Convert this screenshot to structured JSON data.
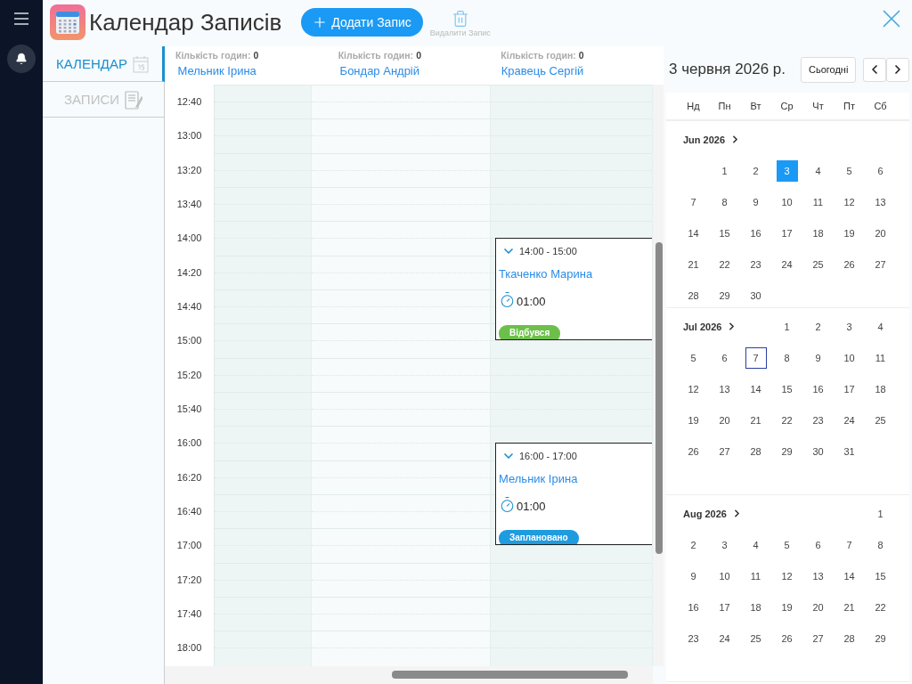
{
  "app": {
    "title": "Календар Записів",
    "add_button": "Додати Запис",
    "delete_button": "Видалити Запис"
  },
  "nav": [
    {
      "label": "КАЛЕНДАР",
      "kind": "calendar",
      "selected": true
    },
    {
      "label": "ЗАПИСИ",
      "kind": "records",
      "selected": false
    }
  ],
  "columns": [
    {
      "hours_label": "Кількість годин:",
      "hours": "0",
      "name": "Мельник Ірина"
    },
    {
      "hours_label": "Кількість годин:",
      "hours": "0",
      "name": "Бондар Андрій"
    },
    {
      "hours_label": "Кількість годин:",
      "hours": "0",
      "name": "Кравець Сергій",
      "events": [
        {
          "time": "14:00 - 15:00",
          "client": "Ткаченко Марина",
          "duration": "01:00",
          "status": "Відбувся",
          "color": "#6cc04a"
        },
        {
          "time": "16:00 - 17:00",
          "client": "Мельник Ірина",
          "duration": "01:00",
          "status": "Заплановано",
          "color": "#1f9be0"
        }
      ]
    }
  ],
  "times": [
    "12:40",
    "13:00",
    "13:20",
    "13:40",
    "14:00",
    "14:20",
    "14:40",
    "15:00",
    "15:20",
    "15:40",
    "16:00",
    "16:20",
    "16:40",
    "17:00",
    "17:20",
    "17:40",
    "18:00"
  ],
  "date_picker": {
    "title": "3 червня 2026 р.",
    "today_button": "Сьогодні",
    "weekdays": [
      "Нд",
      "Пн",
      "Вт",
      "Ср",
      "Чт",
      "Пт",
      "Сб"
    ],
    "months": [
      {
        "label": "Jun 2026",
        "weeks": [
          [
            {
              "kind": "blank"
            },
            {
              "kind": "day",
              "day": "1",
              "selected": false,
              "today": false
            },
            {
              "kind": "day",
              "day": "2",
              "selected": false,
              "today": false
            },
            {
              "kind": "day",
              "day": "3",
              "selected": true,
              "today": false
            },
            {
              "kind": "day",
              "day": "4",
              "selected": false,
              "today": false
            },
            {
              "kind": "day",
              "day": "5",
              "selected": false,
              "today": false
            },
            {
              "kind": "day",
              "day": "6",
              "selected": false,
              "today": false
            }
          ],
          [
            {
              "kind": "day",
              "day": "7",
              "selected": false,
              "today": false
            },
            {
              "kind": "day",
              "day": "8",
              "selected": false,
              "today": false
            },
            {
              "kind": "day",
              "day": "9",
              "selected": false,
              "today": false
            },
            {
              "kind": "day",
              "day": "10",
              "selected": false,
              "today": false
            },
            {
              "kind": "day",
              "day": "11",
              "selected": false,
              "today": false
            },
            {
              "kind": "day",
              "day": "12",
              "selected": false,
              "today": false
            },
            {
              "kind": "day",
              "day": "13",
              "selected": false,
              "today": false
            }
          ],
          [
            {
              "kind": "day",
              "day": "14",
              "selected": false,
              "today": false
            },
            {
              "kind": "day",
              "day": "15",
              "selected": false,
              "today": false
            },
            {
              "kind": "day",
              "day": "16",
              "selected": false,
              "today": false
            },
            {
              "kind": "day",
              "day": "17",
              "selected": false,
              "today": false
            },
            {
              "kind": "day",
              "day": "18",
              "selected": false,
              "today": false
            },
            {
              "kind": "day",
              "day": "19",
              "selected": false,
              "today": false
            },
            {
              "kind": "day",
              "day": "20",
              "selected": false,
              "today": false
            }
          ],
          [
            {
              "kind": "day",
              "day": "21",
              "selected": false,
              "today": false
            },
            {
              "kind": "day",
              "day": "22",
              "selected": false,
              "today": false
            },
            {
              "kind": "day",
              "day": "23",
              "selected": false,
              "today": false
            },
            {
              "kind": "day",
              "day": "24",
              "selected": false,
              "today": false
            },
            {
              "kind": "day",
              "day": "25",
              "selected": false,
              "today": false
            },
            {
              "kind": "day",
              "day": "26",
              "selected": false,
              "today": false
            },
            {
              "kind": "day",
              "day": "27",
              "selected": false,
              "today": false
            }
          ],
          [
            {
              "kind": "day",
              "day": "28",
              "selected": false,
              "today": false
            },
            {
              "kind": "day",
              "day": "29",
              "selected": false,
              "today": false
            },
            {
              "kind": "day",
              "day": "30",
              "selected": false,
              "today": false
            }
          ]
        ]
      },
      {
        "label": "Jul 2026",
        "weeks": [
          [
            {
              "kind": "blank"
            },
            {
              "kind": "blank"
            },
            {
              "kind": "blank"
            },
            {
              "kind": "day",
              "day": "1",
              "selected": false,
              "today": false
            },
            {
              "kind": "day",
              "day": "2",
              "selected": false,
              "today": false
            },
            {
              "kind": "day",
              "day": "3",
              "selected": false,
              "today": false
            },
            {
              "kind": "day",
              "day": "4",
              "selected": false,
              "today": false
            }
          ],
          [
            {
              "kind": "day",
              "day": "5",
              "selected": false,
              "today": false
            },
            {
              "kind": "day",
              "day": "6",
              "selected": false,
              "today": false
            },
            {
              "kind": "day",
              "day": "7",
              "selected": false,
              "today": true
            },
            {
              "kind": "day",
              "day": "8",
              "selected": false,
              "today": false
            },
            {
              "kind": "day",
              "day": "9",
              "selected": false,
              "today": false
            },
            {
              "kind": "day",
              "day": "10",
              "selected": false,
              "today": false
            },
            {
              "kind": "day",
              "day": "11",
              "selected": false,
              "today": false
            }
          ],
          [
            {
              "kind": "day",
              "day": "12",
              "selected": false,
              "today": false
            },
            {
              "kind": "day",
              "day": "13",
              "selected": false,
              "today": false
            },
            {
              "kind": "day",
              "day": "14",
              "selected": false,
              "today": false
            },
            {
              "kind": "day",
              "day": "15",
              "selected": false,
              "today": false
            },
            {
              "kind": "day",
              "day": "16",
              "selected": false,
              "today": false
            },
            {
              "kind": "day",
              "day": "17",
              "selected": false,
              "today": false
            },
            {
              "kind": "day",
              "day": "18",
              "selected": false,
              "today": false
            }
          ],
          [
            {
              "kind": "day",
              "day": "19",
              "selected": false,
              "today": false
            },
            {
              "kind": "day",
              "day": "20",
              "selected": false,
              "today": false
            },
            {
              "kind": "day",
              "day": "21",
              "selected": false,
              "today": false
            },
            {
              "kind": "day",
              "day": "22",
              "selected": false,
              "today": false
            },
            {
              "kind": "day",
              "day": "23",
              "selected": false,
              "today": false
            },
            {
              "kind": "day",
              "day": "24",
              "selected": false,
              "today": false
            },
            {
              "kind": "day",
              "day": "25",
              "selected": false,
              "today": false
            }
          ],
          [
            {
              "kind": "day",
              "day": "26",
              "selected": false,
              "today": false
            },
            {
              "kind": "day",
              "day": "27",
              "selected": false,
              "today": false
            },
            {
              "kind": "day",
              "day": "28",
              "selected": false,
              "today": false
            },
            {
              "kind": "day",
              "day": "29",
              "selected": false,
              "today": false
            },
            {
              "kind": "day",
              "day": "30",
              "selected": false,
              "today": false
            },
            {
              "kind": "day",
              "day": "31",
              "selected": false,
              "today": false
            }
          ]
        ]
      },
      {
        "label": "Aug 2026",
        "weeks": [
          [
            {
              "kind": "blank"
            },
            {
              "kind": "blank"
            },
            {
              "kind": "blank"
            },
            {
              "kind": "blank"
            },
            {
              "kind": "blank"
            },
            {
              "kind": "blank"
            },
            {
              "kind": "day",
              "day": "1",
              "selected": false,
              "today": false
            }
          ],
          [
            {
              "kind": "day",
              "day": "2",
              "selected": false,
              "today": false
            },
            {
              "kind": "day",
              "day": "3",
              "selected": false,
              "today": false
            },
            {
              "kind": "day",
              "day": "4",
              "selected": false,
              "today": false
            },
            {
              "kind": "day",
              "day": "5",
              "selected": false,
              "today": false
            },
            {
              "kind": "day",
              "day": "6",
              "selected": false,
              "today": false
            },
            {
              "kind": "day",
              "day": "7",
              "selected": false,
              "today": false
            },
            {
              "kind": "day",
              "day": "8",
              "selected": false,
              "today": false
            }
          ],
          [
            {
              "kind": "day",
              "day": "9",
              "selected": false,
              "today": false
            },
            {
              "kind": "day",
              "day": "10",
              "selected": false,
              "today": false
            },
            {
              "kind": "day",
              "day": "11",
              "selected": false,
              "today": false
            },
            {
              "kind": "day",
              "day": "12",
              "selected": false,
              "today": false
            },
            {
              "kind": "day",
              "day": "13",
              "selected": false,
              "today": false
            },
            {
              "kind": "day",
              "day": "14",
              "selected": false,
              "today": false
            },
            {
              "kind": "day",
              "day": "15",
              "selected": false,
              "today": false
            }
          ],
          [
            {
              "kind": "day",
              "day": "16",
              "selected": false,
              "today": false
            },
            {
              "kind": "day",
              "day": "17",
              "selected": false,
              "today": false
            },
            {
              "kind": "day",
              "day": "18",
              "selected": false,
              "today": false
            },
            {
              "kind": "day",
              "day": "19",
              "selected": false,
              "today": false
            },
            {
              "kind": "day",
              "day": "20",
              "selected": false,
              "today": false
            },
            {
              "kind": "day",
              "day": "21",
              "selected": false,
              "today": false
            },
            {
              "kind": "day",
              "day": "22",
              "selected": false,
              "today": false
            }
          ],
          [
            {
              "kind": "day",
              "day": "23",
              "selected": false,
              "today": false
            },
            {
              "kind": "day",
              "day": "24",
              "selected": false,
              "today": false
            },
            {
              "kind": "day",
              "day": "25",
              "selected": false,
              "today": false
            },
            {
              "kind": "day",
              "day": "26",
              "selected": false,
              "today": false
            },
            {
              "kind": "day",
              "day": "27",
              "selected": false,
              "today": false
            },
            {
              "kind": "day",
              "day": "28",
              "selected": false,
              "today": false
            },
            {
              "kind": "day",
              "day": "29",
              "selected": false,
              "today": false
            }
          ]
        ]
      }
    ]
  }
}
